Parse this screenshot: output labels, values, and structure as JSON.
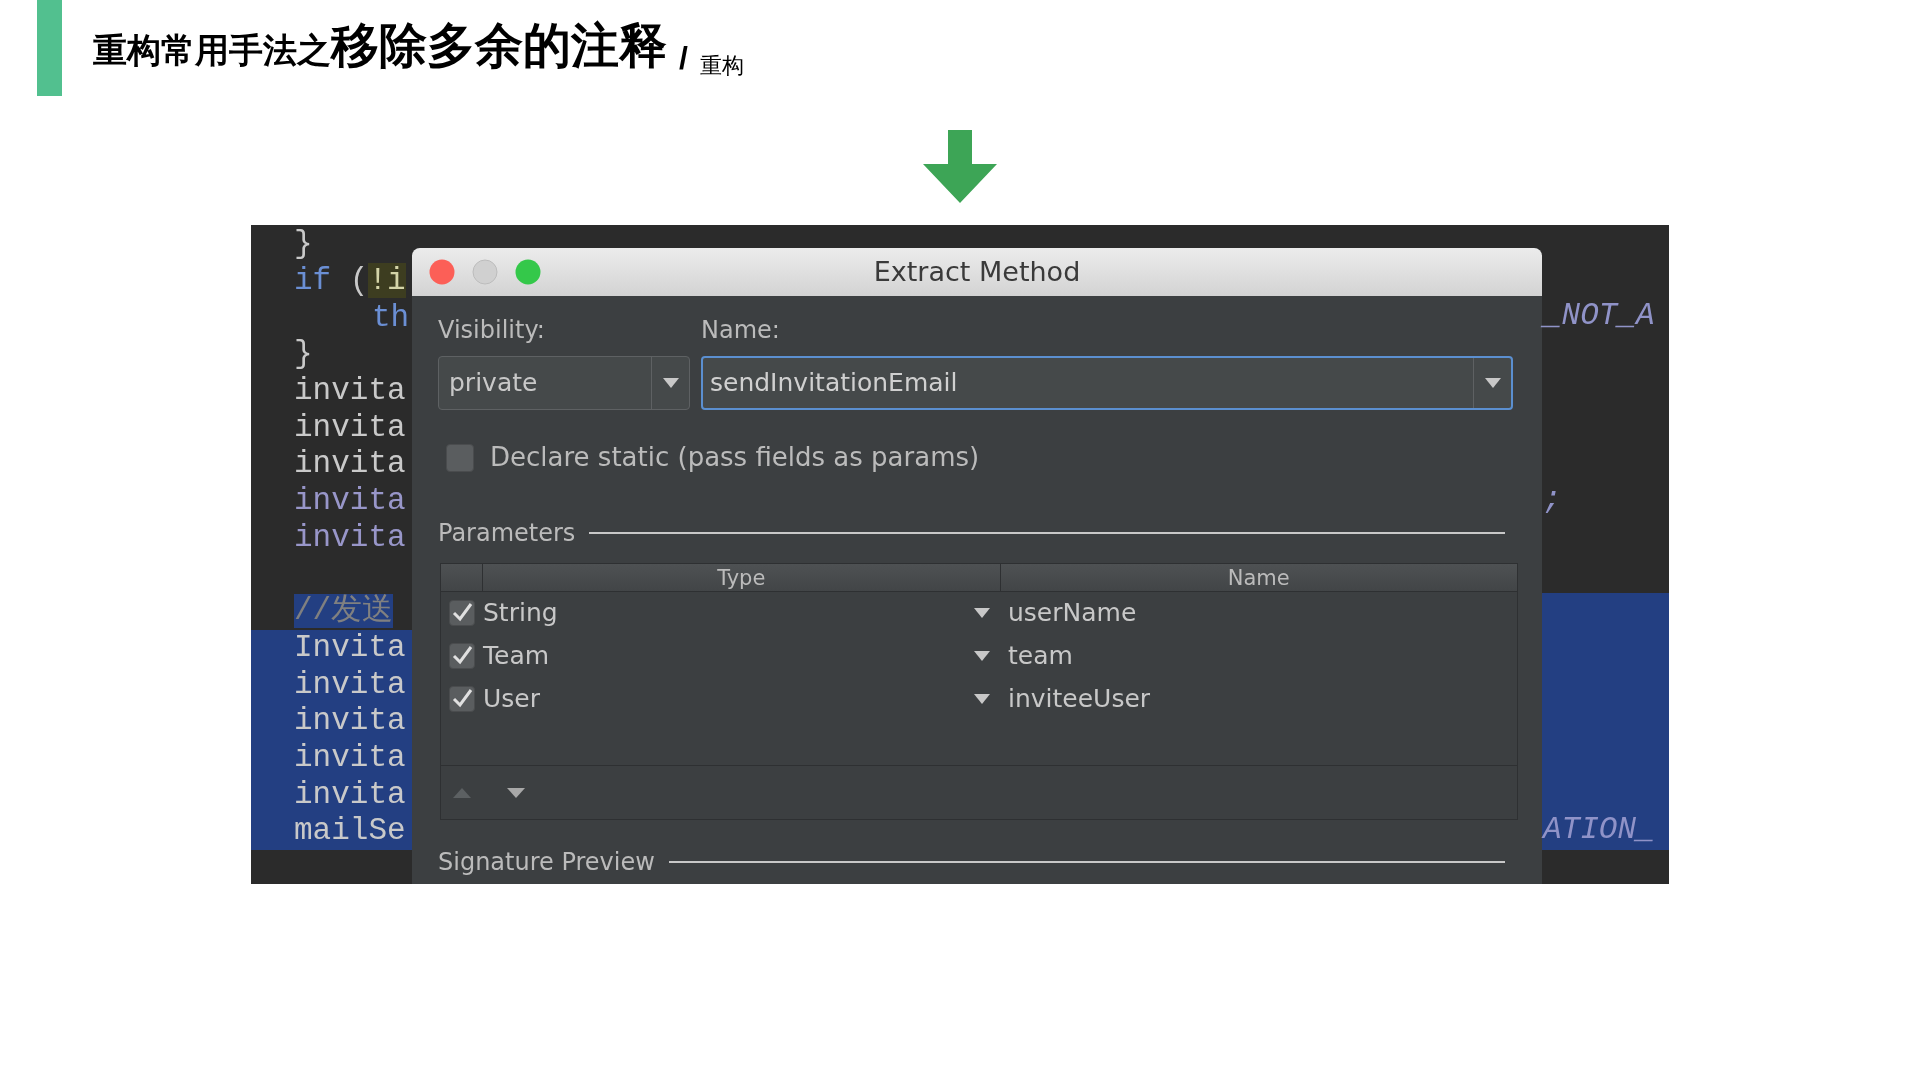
{
  "slide": {
    "title": {
      "lead": "重构常用手法之",
      "main": "移除多余的注释",
      "separator": "/",
      "section": "重构"
    }
  },
  "code": {
    "lines": [
      {
        "segments": [
          {
            "text": "}",
            "kind": "plain"
          }
        ],
        "selected": false
      },
      {
        "segments": [
          {
            "text": "if",
            "kind": "keyword"
          },
          {
            "text": " (",
            "kind": "plain"
          },
          {
            "text": "!i",
            "kind": "highlight"
          }
        ],
        "selected": false
      },
      {
        "segments": [
          {
            "text": "th",
            "kind": "keyword"
          }
        ],
        "indented": true,
        "tail": "_NOT_A",
        "selected": false
      },
      {
        "segments": [
          {
            "text": "}",
            "kind": "plain"
          }
        ],
        "selected": false
      },
      {
        "segments": [
          {
            "text": "invita",
            "kind": "plain"
          }
        ],
        "selected": false
      },
      {
        "segments": [
          {
            "text": "invita",
            "kind": "plain"
          }
        ],
        "selected": false
      },
      {
        "segments": [
          {
            "text": "invita",
            "kind": "plain"
          }
        ],
        "selected": false
      },
      {
        "segments": [
          {
            "text": "invita",
            "kind": "field"
          }
        ],
        "tail": ";",
        "selected": false
      },
      {
        "segments": [
          {
            "text": "invita",
            "kind": "field"
          }
        ],
        "selected": false
      },
      {
        "segments": [
          {
            "text": "//发送",
            "kind": "comment"
          }
        ],
        "blank_before": true,
        "selected": true
      },
      {
        "segments": [
          {
            "text": "Invita",
            "kind": "plain"
          }
        ],
        "selected": true
      },
      {
        "segments": [
          {
            "text": "invita",
            "kind": "plain"
          }
        ],
        "selected": true
      },
      {
        "segments": [
          {
            "text": "invita",
            "kind": "plain"
          }
        ],
        "selected": true
      },
      {
        "segments": [
          {
            "text": "invita",
            "kind": "plain"
          }
        ],
        "selected": true
      },
      {
        "segments": [
          {
            "text": "invita",
            "kind": "plain"
          }
        ],
        "selected": true
      },
      {
        "segments": [
          {
            "text": "mailSe",
            "kind": "plain"
          }
        ],
        "tail": "ATION_",
        "selected": true
      }
    ]
  },
  "dialog": {
    "title": "Extract Method",
    "visibility": {
      "label": "Visibility:",
      "value": "private"
    },
    "name": {
      "label": "Name:",
      "value": "sendInvitationEmail"
    },
    "declare_static": {
      "label": "Declare static (pass fields as params)",
      "checked": false
    },
    "parameters": {
      "title": "Parameters",
      "columns": [
        "Type",
        "Name"
      ],
      "rows": [
        {
          "checked": true,
          "type": "String",
          "name": "userName"
        },
        {
          "checked": true,
          "type": "Team",
          "name": "team"
        },
        {
          "checked": true,
          "type": "User",
          "name": "inviteeUser"
        }
      ],
      "toolbar": [
        {
          "kind": "up",
          "disabled": true
        },
        {
          "kind": "down",
          "disabled": false
        }
      ]
    },
    "signature_preview": {
      "title": "Signature Preview"
    }
  }
}
